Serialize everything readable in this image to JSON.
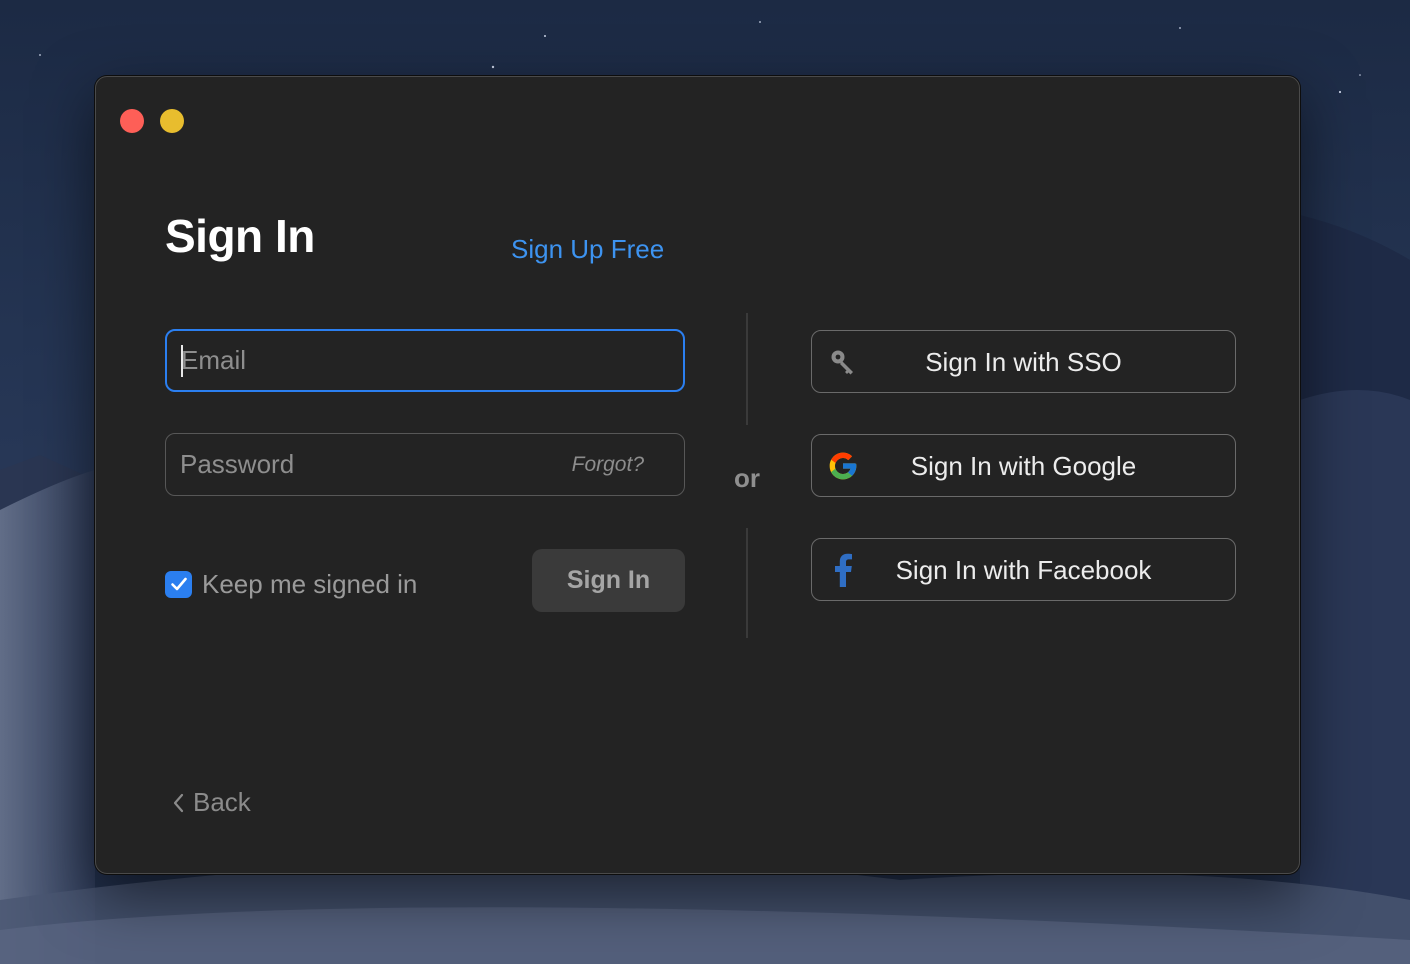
{
  "window": {
    "controls": [
      "close",
      "minimize"
    ]
  },
  "header": {
    "title": "Sign In",
    "signup_link": "Sign Up Free"
  },
  "form": {
    "email": {
      "placeholder": "Email",
      "value": ""
    },
    "password": {
      "placeholder": "Password",
      "value": ""
    },
    "forgot_link": "Forgot?",
    "keep_signed_in": {
      "label": "Keep me signed in",
      "checked": true
    },
    "submit_label": "Sign In"
  },
  "divider": {
    "label": "or"
  },
  "alt_sign_in": [
    {
      "id": "sso",
      "label": "Sign In with SSO",
      "icon": "key-icon"
    },
    {
      "id": "google",
      "label": "Sign In with Google",
      "icon": "google-icon"
    },
    {
      "id": "facebook",
      "label": "Sign In with Facebook",
      "icon": "facebook-icon"
    }
  ],
  "footer": {
    "back_label": "Back"
  },
  "colors": {
    "accent": "#2b7ff0",
    "link": "#3d93f0",
    "window_bg": "#232323",
    "close": "#fe5f57",
    "minimize": "#e8bd2e"
  }
}
